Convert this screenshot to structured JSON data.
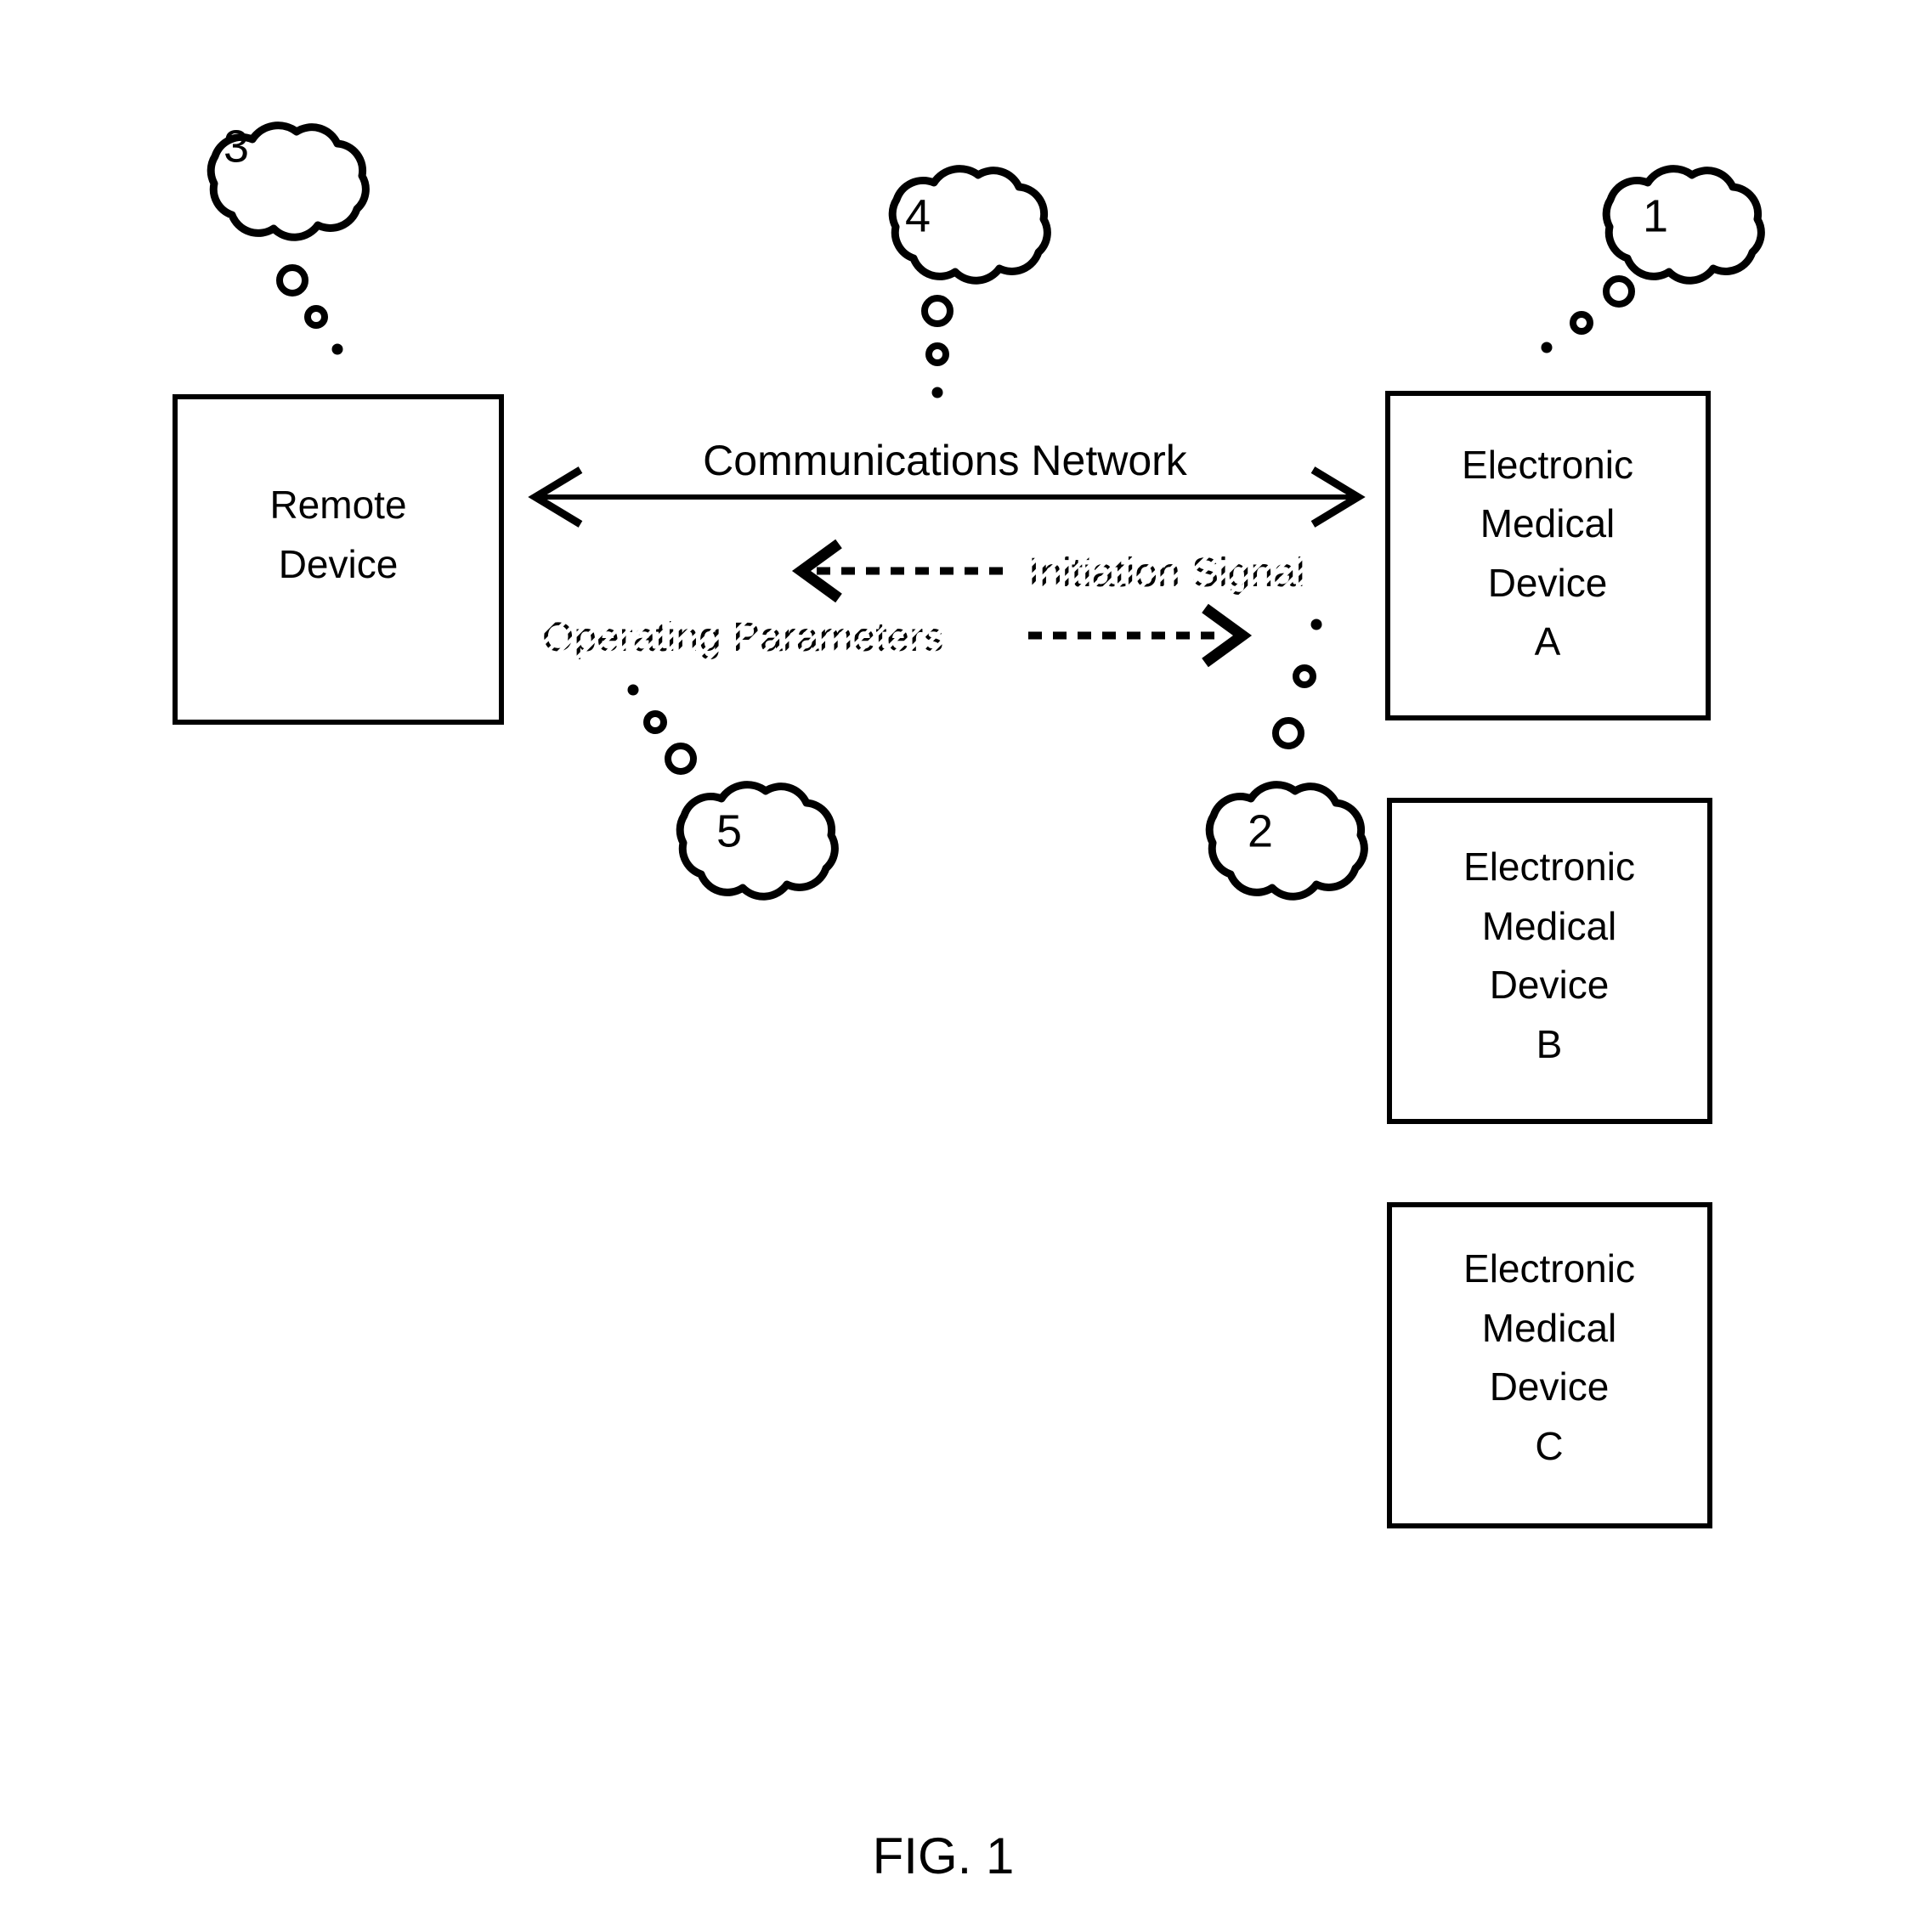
{
  "figure": {
    "caption": "FIG. 1",
    "network_label": "Communications Network",
    "initiation_label": "Initiation Signal",
    "operating_label": "Operating Parameters",
    "colors": {
      "ink": "#000000",
      "paper": "#ffffff"
    }
  },
  "boxes": {
    "remote_device": {
      "line1": "Remote",
      "line2": "Device"
    },
    "emd_a": {
      "line1": "Electronic",
      "line2": "Medical",
      "line3": "Device",
      "line4": "A"
    },
    "emd_b": {
      "line1": "Electronic",
      "line2": "Medical",
      "line3": "Device",
      "line4": "B"
    },
    "emd_c": {
      "line1": "Electronic",
      "line2": "Medical",
      "line3": "Device",
      "line4": "C"
    }
  },
  "callouts": {
    "one": "1",
    "two": "2",
    "three": "3",
    "four": "4",
    "five": "5"
  }
}
